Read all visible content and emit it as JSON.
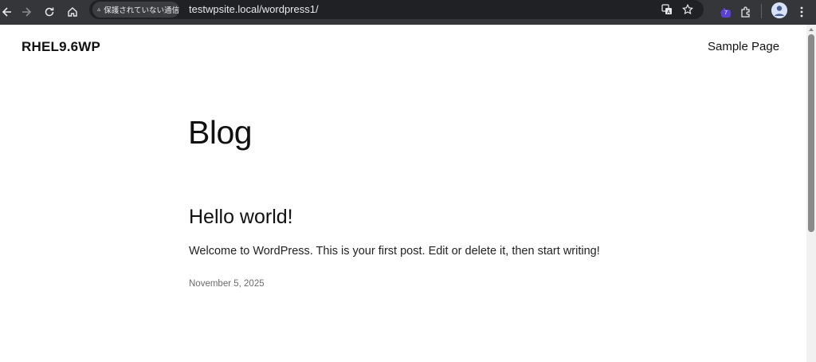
{
  "browser": {
    "security_label": "保護されていない通信",
    "url": "testwpsite.local/wordpress1/",
    "extension_badge": "7",
    "colors": {
      "toolbar": "#35363a",
      "omnibox": "#202124",
      "badge": "#5b3fd6"
    },
    "icons": [
      "back-icon",
      "forward-icon",
      "reload-icon",
      "home-icon",
      "warning-icon",
      "translate-icon",
      "star-icon",
      "extension-icon",
      "puzzle-icon",
      "avatar",
      "menu-icon"
    ]
  },
  "site": {
    "title": "RHEL9.6WP",
    "nav": [
      "Sample Page"
    ]
  },
  "main": {
    "heading": "Blog",
    "posts": [
      {
        "title": "Hello world!",
        "excerpt": "Welcome to WordPress. This is your first post. Edit or delete it, then start writing!",
        "date": "November 5, 2025"
      }
    ]
  }
}
